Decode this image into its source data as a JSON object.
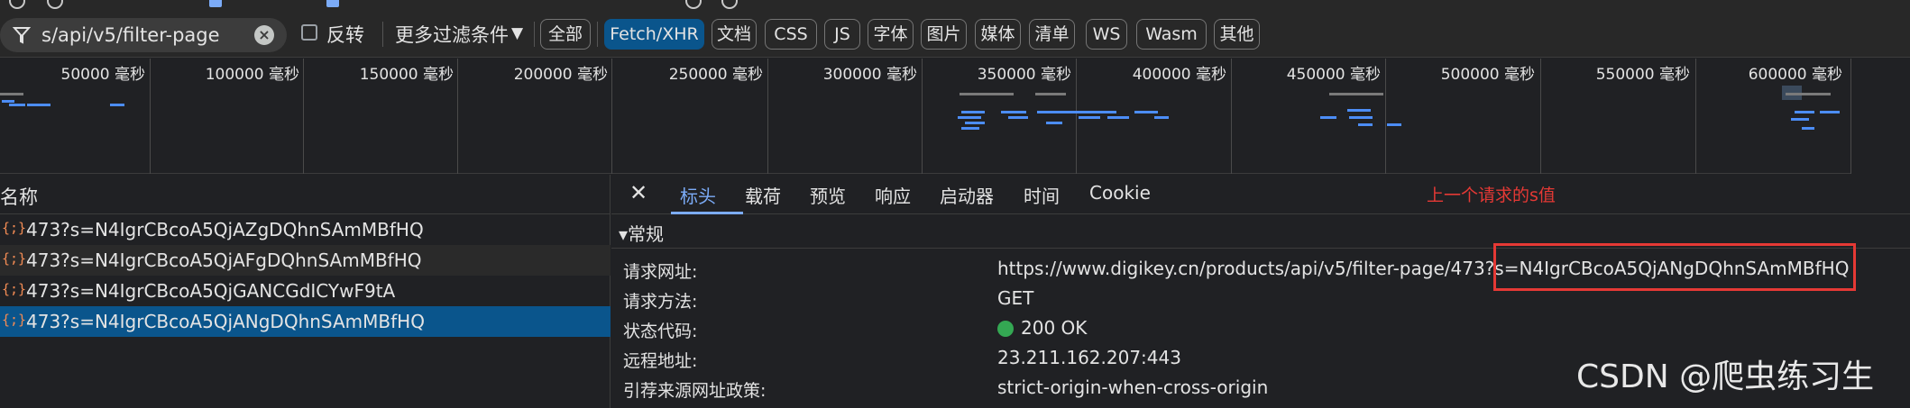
{
  "filter_bar": {
    "search_value": "s/api/v5/filter-page",
    "invert_label": "反转",
    "more_filters_label": "更多过滤条件",
    "chips": [
      "全部",
      "Fetch/XHR",
      "文档",
      "CSS",
      "JS",
      "字体",
      "图片",
      "媒体",
      "清单",
      "WS",
      "Wasm",
      "其他"
    ],
    "active_chip": "Fetch/XHR"
  },
  "overview": {
    "ticks": [
      "50000 毫秒",
      "100000 毫秒",
      "150000 毫秒",
      "200000 毫秒",
      "250000 毫秒",
      "300000 毫秒",
      "350000 毫秒",
      "400000 毫秒",
      "450000 毫秒",
      "500000 毫秒",
      "550000 毫秒",
      "600000 毫秒"
    ]
  },
  "request_list": {
    "header": "名称",
    "rows": [
      "473?s=N4IgrCBcoA5QjAZgDQhnSAmMBfHQ",
      "473?s=N4IgrCBcoA5QjAFgDQhnSAmMBfHQ",
      "473?s=N4IgrCBcoA5QjGANCGdICYwF9tA",
      "473?s=N4IgrCBcoA5QjANgDQhnSAmMBfHQ"
    ],
    "selected_index": 3,
    "icon_glyph": "{;}"
  },
  "details": {
    "close_glyph": "✕",
    "tabs": [
      "标头",
      "载荷",
      "预览",
      "响应",
      "启动器",
      "时间",
      "Cookie"
    ],
    "active_tab": "标头",
    "section_title": "▾常规",
    "fields": [
      {
        "key": "请求网址:",
        "value": "https://www.digikey.cn/products/api/v5/filter-page/473?s=N4IgrCBcoA5QjANgDQhnSAmMBfHQ"
      },
      {
        "key": "请求方法:",
        "value": "GET"
      },
      {
        "key": "状态代码:",
        "value": "200 OK"
      },
      {
        "key": "远程地址:",
        "value": "23.211.162.207:443"
      },
      {
        "key": "引荐来源网址政策:",
        "value": "strict-origin-when-cross-origin"
      }
    ],
    "status_color": "#34a853"
  },
  "annotation": "上一个请求的s值",
  "watermark": "CSDN @爬虫练习生",
  "colors": {
    "accent": "#0a558c",
    "link": "#7cacf8",
    "annotation_red": "#e53935"
  }
}
